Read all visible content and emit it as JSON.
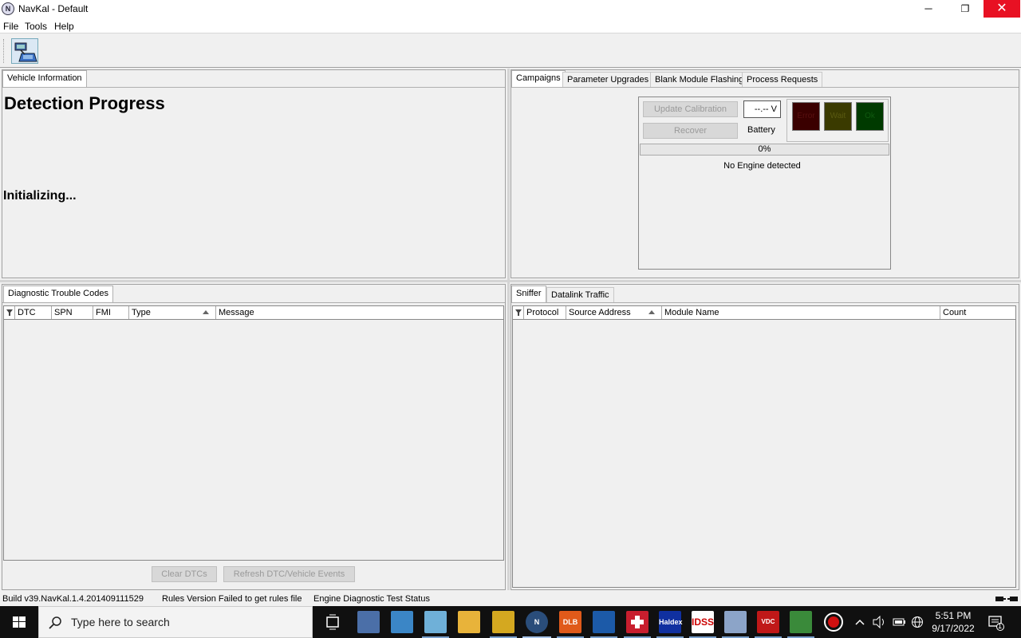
{
  "window": {
    "title": "NavKal - Default",
    "app_icon_letter": "N",
    "minimize": "─",
    "maximize": "❐",
    "close": "✕"
  },
  "menu": {
    "items": [
      "File",
      "Tools",
      "Help"
    ]
  },
  "vehicle_panel": {
    "tab": "Vehicle Information",
    "heading": "Detection Progress",
    "status": "Initializing..."
  },
  "campaign_panel": {
    "tabs": [
      "Campaigns",
      "Parameter Upgrades",
      "Blank Module Flashing",
      "Process Requests"
    ],
    "update_button": "Update Calibration",
    "recover_button": "Recover",
    "voltage": "--.-- V",
    "battery_label": "Battery",
    "lights": [
      "Error",
      "Wait",
      "Ok"
    ],
    "progress": "0%",
    "progress_value": 0,
    "engine_status": "No Engine detected"
  },
  "dtc_panel": {
    "tab": "Diagnostic Trouble Codes",
    "columns": [
      "DTC",
      "SPN",
      "FMI",
      "Type",
      "Message"
    ],
    "clear_button": "Clear DTCs",
    "refresh_button": "Refresh DTC/Vehicle Events"
  },
  "sniffer_panel": {
    "tabs": [
      "Sniffer",
      "Datalink Traffic"
    ],
    "columns": [
      "Protocol",
      "Source Address",
      "Module Name",
      "Count"
    ]
  },
  "statusbar": {
    "build": "Build v39.NavKal.1.4.201409111529",
    "rules": "Rules Version Failed to get rules file",
    "engine_diag": "Engine Diagnostic Test Status"
  },
  "taskbar": {
    "search_placeholder": "Type here to search",
    "time": "5:51 PM",
    "date": "9/17/2022",
    "notification_count": "1",
    "apps": [
      {
        "label": "",
        "color": "#5a7fb0",
        "icon": "task-view"
      },
      {
        "label": "",
        "color": "#4b6fa8",
        "icon": "network"
      },
      {
        "label": "",
        "color": "#3b86c6",
        "icon": "laptop"
      },
      {
        "label": "",
        "color": "#6fb0d8",
        "icon": "tablet"
      },
      {
        "label": "",
        "color": "#e8b33a",
        "icon": "folder"
      },
      {
        "label": "",
        "color": "#d4a820",
        "icon": "calculator"
      },
      {
        "label": "N",
        "color": "#2a4d7a",
        "icon": "navkal"
      },
      {
        "label": "DLB",
        "color": "#e05a1a",
        "icon": "dlb"
      },
      {
        "label": "",
        "color": "#1c5aa8",
        "icon": "allison"
      },
      {
        "label": "",
        "color": "#c81e2e",
        "icon": "swiss"
      },
      {
        "label": "Haldex",
        "color": "#1030a0",
        "icon": "haldex"
      },
      {
        "label": "IDSS",
        "color": "#ffffff",
        "icon": "idss"
      },
      {
        "label": "",
        "color": "#8ca4c8",
        "icon": "printer"
      },
      {
        "label": "VDC",
        "color": "#c01818",
        "icon": "vdc"
      },
      {
        "label": "",
        "color": "#3a8a3a",
        "icon": "excel"
      },
      {
        "label": "",
        "color": "#d01010",
        "icon": "record"
      }
    ]
  }
}
